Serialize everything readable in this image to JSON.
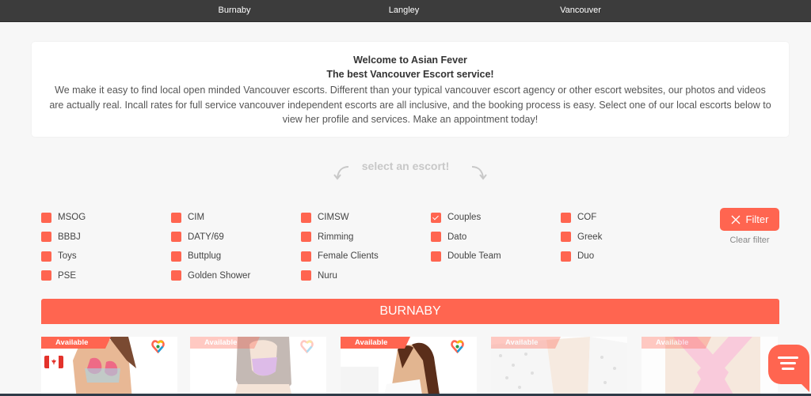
{
  "topnav": {
    "links": [
      {
        "label": "Burnaby"
      },
      {
        "label": "Langley"
      },
      {
        "label": "Vancouver"
      }
    ]
  },
  "welcome": {
    "title": "Welcome to Asian Fever",
    "subtitle": "The best Vancouver Escort service!",
    "body": "We make it easy to find local open minded Vancouver escorts. Different than your typical vancouver escort agency or other escort websites, our photos and videos are actually real. Incall rates for full service vancouver independent escorts are all inclusive, and the booking process is easy. Select one of our local escorts below to view her profile and services. Make an appointment today!"
  },
  "select_hint": "select an escort!",
  "filters": {
    "columns": [
      [
        {
          "label": "MSOG",
          "checked": false
        },
        {
          "label": "BBBJ",
          "checked": false
        },
        {
          "label": "Toys",
          "checked": false
        },
        {
          "label": "PSE",
          "checked": false
        }
      ],
      [
        {
          "label": "CIM",
          "checked": false
        },
        {
          "label": "DATY/69",
          "checked": false
        },
        {
          "label": "Buttplug",
          "checked": false
        },
        {
          "label": "Golden Shower",
          "checked": false
        }
      ],
      [
        {
          "label": "CIMSW",
          "checked": false
        },
        {
          "label": "Rimming",
          "checked": false
        },
        {
          "label": "Female Clients",
          "checked": false
        },
        {
          "label": "Nuru",
          "checked": false
        }
      ],
      [
        {
          "label": "Couples",
          "checked": true
        },
        {
          "label": "Dato",
          "checked": false
        },
        {
          "label": "Double Team",
          "checked": false
        }
      ],
      [
        {
          "label": "COF",
          "checked": false
        },
        {
          "label": "Greek",
          "checked": false
        },
        {
          "label": "Duo",
          "checked": false
        }
      ]
    ],
    "filter_button": "Filter",
    "clear_filter": "Clear filter"
  },
  "region": {
    "title": "BURNABY"
  },
  "cards": [
    {
      "badge": "Available",
      "faded": false,
      "flag": "canada-flag-icon",
      "heart": true
    },
    {
      "badge": "Available",
      "faded": true,
      "heart": true
    },
    {
      "badge": "Available",
      "faded": false,
      "heart": true
    },
    {
      "badge": "Available",
      "faded": true,
      "heart": false
    },
    {
      "badge": "Available",
      "faded": true,
      "heart": false
    }
  ],
  "colors": {
    "accent": "#ff6550",
    "nav_bg": "#3c3c3c",
    "page_bg": "#f7f7f7"
  }
}
